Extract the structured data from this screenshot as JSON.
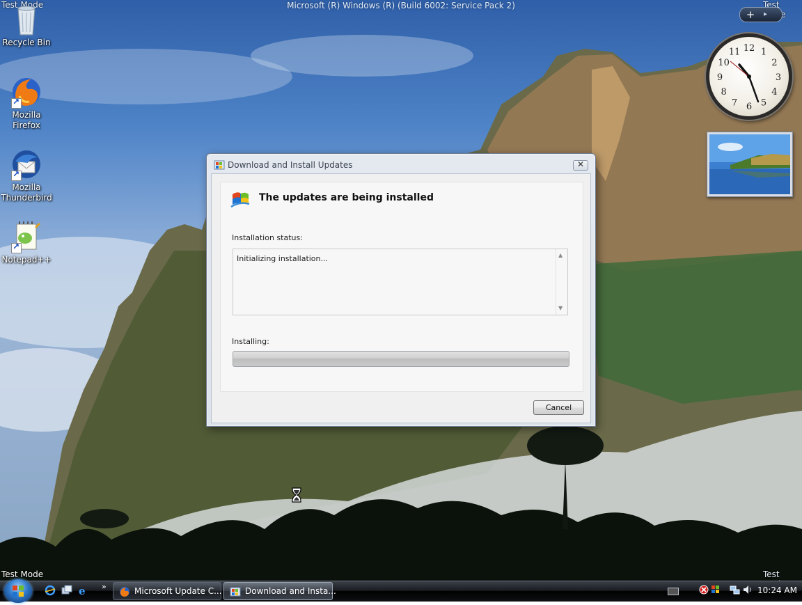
{
  "os_banner": "Microsoft (R) Windows (R) (Build 6002: Service Pack 2)",
  "watermark": "Test Mode",
  "desktop_icons": [
    {
      "label": "Recycle Bin",
      "icon": "recycle-bin-icon"
    },
    {
      "label": "Mozilla Firefox",
      "icon": "firefox-icon"
    },
    {
      "label": "Mozilla Thunderbird",
      "icon": "thunderbird-icon"
    },
    {
      "label": "Notepad++",
      "icon": "notepad-plus-plus-icon"
    }
  ],
  "gadgets": {
    "toolbar_add": "+",
    "clock_numbers": [
      "12",
      "1",
      "2",
      "3",
      "4",
      "5",
      "6",
      "7",
      "8",
      "9",
      "10",
      "11"
    ]
  },
  "dialog": {
    "title": "Download and Install Updates",
    "heading": "The updates are being installed",
    "status_label": "Installation status:",
    "status_text": "Initializing installation...",
    "progress_label": "Installing:",
    "progress_fraction": 0.0,
    "cancel_label": "Cancel"
  },
  "taskbar": {
    "quick_launch_more": "»",
    "tasks": [
      {
        "label": "Microsoft Update C...",
        "icon": "firefox-icon",
        "active": false
      },
      {
        "label": "Download and Insta...",
        "icon": "windows-update-icon",
        "active": true
      }
    ],
    "clock": "10:24 AM"
  },
  "colors": {
    "dialog_bg": "#f0f0f0",
    "taskbar": "#1a1d22",
    "accent": "#2f79c9"
  }
}
